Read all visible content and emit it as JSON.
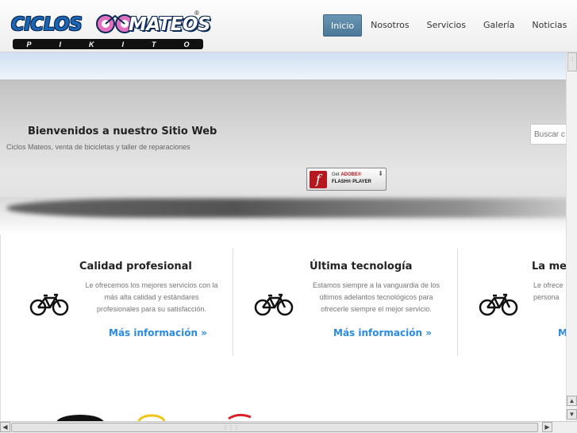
{
  "brand": {
    "word1": "CICLOS",
    "word2": "MATEOS",
    "registered": "®",
    "band_letters": [
      "P",
      "I",
      "K",
      "I",
      "T",
      "O"
    ]
  },
  "nav": {
    "items": [
      {
        "label": "Inicio",
        "active": true
      },
      {
        "label": "Nosotros",
        "active": false
      },
      {
        "label": "Servicios",
        "active": false
      },
      {
        "label": "Galería",
        "active": false
      },
      {
        "label": "Noticias",
        "active": false
      }
    ]
  },
  "hero": {
    "title": "Bienvenidos a nuestro Sitio Web",
    "subtitle": "Ciclos Mateos, venta de bicicletas y taller de reparaciones",
    "flash": {
      "icon_letter": "f",
      "line1_prefix": "Get",
      "line1_brand": "ADOBE®",
      "line2": "FLASH® PLAYER",
      "download_icon": "download-arrow-icon"
    }
  },
  "search": {
    "placeholder": "Buscar c"
  },
  "features": [
    {
      "title": "Calidad profesional",
      "desc_lines": [
        "Le ofrecemos los mejores servicios con la",
        "más alta calidad y estándares",
        "profesionales para su satisfacción."
      ],
      "link": "Más información »",
      "icon": "bicycle-icon"
    },
    {
      "title": "Última tecnología",
      "desc_lines": [
        "Estamos siempre a la vanguardia de los",
        "últimos adelantos tecnológicos para",
        "ofrecerle siempre el mejor servicio."
      ],
      "link": "Más información »",
      "icon": "bicycle-icon"
    },
    {
      "title": "La mejo",
      "desc_lines": [
        "Le ofrece",
        "persona",
        ""
      ],
      "link": "M",
      "icon": "bicycle-icon"
    }
  ],
  "colors": {
    "brand_blue": "#1a66b4",
    "nav_active": "#4b7898",
    "link_blue": "#2a8be0",
    "flash_red": "#b5181e"
  }
}
